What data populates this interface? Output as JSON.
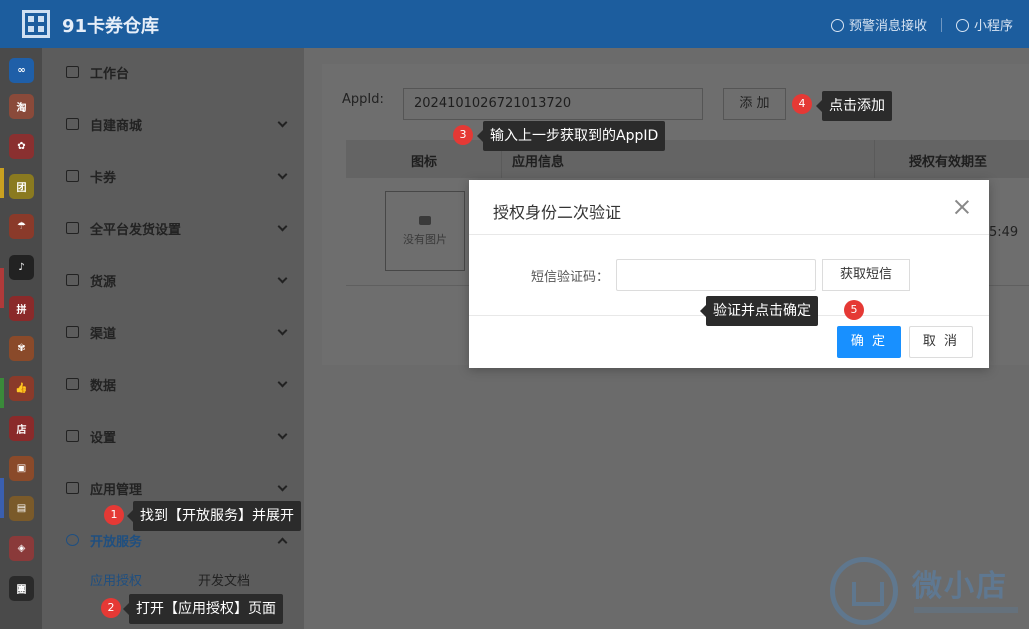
{
  "header": {
    "brand": "91卡券仓库",
    "links": [
      {
        "label": "预警消息接收",
        "icon": "alarm-icon"
      },
      {
        "label": "小程序",
        "icon": "miniprogram-icon"
      }
    ]
  },
  "sidebar": {
    "items": [
      {
        "label": "工作台",
        "icon": "dashboard-icon"
      },
      {
        "label": "自建商城",
        "icon": "store-icon"
      },
      {
        "label": "卡券",
        "icon": "card-icon"
      },
      {
        "label": "全平台发货设置",
        "icon": "grid-icon"
      },
      {
        "label": "货源",
        "icon": "cart-icon"
      },
      {
        "label": "渠道",
        "icon": "bag-icon"
      },
      {
        "label": "数据",
        "icon": "piechart-icon"
      },
      {
        "label": "设置",
        "icon": "gear-icon"
      },
      {
        "label": "应用管理",
        "icon": "apps-icon"
      },
      {
        "label": "开放服务",
        "icon": "link-icon"
      }
    ],
    "sub_items": [
      "应用授权",
      "开发文档"
    ]
  },
  "main": {
    "appid_label": "AppId:",
    "appid_value": "2024101026721013720",
    "add_button": "添 加",
    "table_headers": [
      "图标",
      "应用信息",
      "授权有效期至"
    ],
    "no_image": "没有图片",
    "row_time": "5:49"
  },
  "modal": {
    "title": "授权身份二次验证",
    "sms_label": "短信验证码：",
    "sms_value": "",
    "get_sms_button": "获取短信",
    "confirm_button": "确 定",
    "cancel_button": "取 消"
  },
  "annotations": [
    {
      "num": "1",
      "text": "找到【开放服务】并展开"
    },
    {
      "num": "2",
      "text": "打开【应用授权】页面"
    },
    {
      "num": "3",
      "text": "输入上一步获取到的AppID"
    },
    {
      "num": "4",
      "text": "点击添加"
    },
    {
      "num": "5",
      "text": "验证并点击确定"
    }
  ],
  "watermark": {
    "text": "微小店"
  },
  "colors": {
    "header": "#1c5d9e",
    "primary": "#1890ff",
    "badge": "#e53935"
  }
}
